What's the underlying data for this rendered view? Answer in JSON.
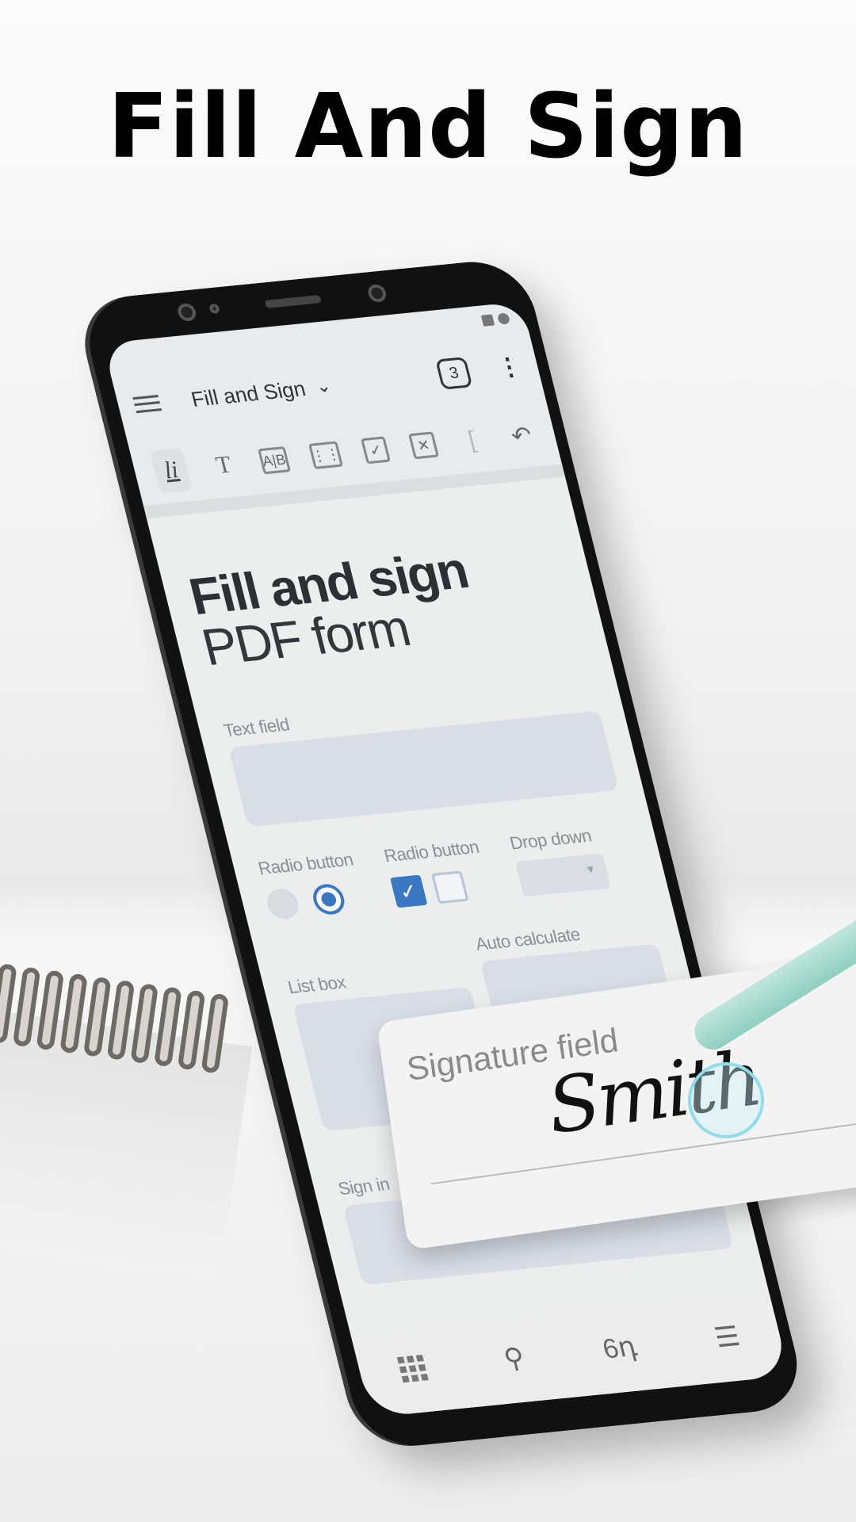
{
  "headline": "Fill And Sign",
  "app": {
    "title": "Fill and Sign",
    "badge_count": "3",
    "toolbar_icons": [
      "signature-icon",
      "text-icon",
      "comb-field-icon",
      "calendar-icon",
      "checkmark-icon",
      "cross-icon",
      "bracket-icon",
      "undo-icon"
    ]
  },
  "document": {
    "title_bold": "Fill and sign",
    "title_light": "PDF form",
    "text_field_label": "Text field",
    "radio_label": "Radio button",
    "checkbox_label": "Radio button",
    "dropdown_label": "Drop down",
    "list_box_label": "List box",
    "auto_calc_label": "Auto calculate",
    "sign_in_label": "Sign in"
  },
  "signature": {
    "label": "Signature field",
    "value": "Smith"
  },
  "bottom_nav": [
    "grid-icon",
    "search-icon",
    "reading-glasses-icon",
    "list-icon"
  ],
  "colors": {
    "accent": "#3b78c4",
    "pen": "#8fcfc0"
  }
}
